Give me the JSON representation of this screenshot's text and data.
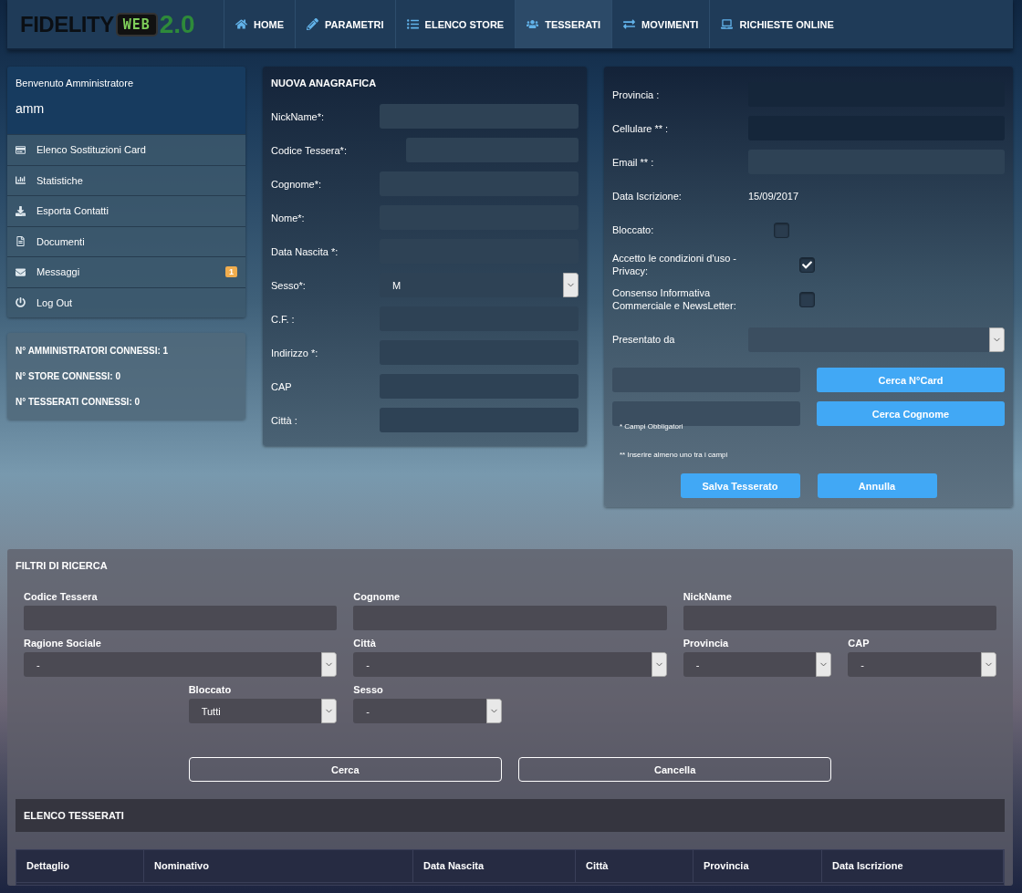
{
  "navbar": {
    "logo": {
      "word": "FIDELITY",
      "screen": "WEB",
      "version": "2.0"
    },
    "items": [
      {
        "label": "HOME",
        "selected": false
      },
      {
        "label": "PARAMETRI",
        "selected": false
      },
      {
        "label": "ELENCO STORE",
        "selected": false
      },
      {
        "label": "TESSERATI",
        "selected": true
      },
      {
        "label": "MOVIMENTI",
        "selected": false
      },
      {
        "label": "RICHIESTE ONLINE",
        "selected": false
      }
    ]
  },
  "sidebar": {
    "welcome": "Benvenuto Amministratore",
    "user": "amm",
    "items": [
      {
        "label": "Elenco Sostituzioni Card"
      },
      {
        "label": "Statistiche"
      },
      {
        "label": "Esporta Contatti"
      },
      {
        "label": "Documenti"
      },
      {
        "label": "Messaggi",
        "badge": "1"
      },
      {
        "label": "Log Out"
      }
    ],
    "stats": [
      "N° AMMINISTRATORI CONNESSI: 1",
      "N° STORE CONNESSI: 0",
      "N° TESSERATI CONNESSI: 0"
    ]
  },
  "new_record": {
    "title": "NUOVA ANAGRAFICA",
    "fields": [
      {
        "label": "NickName*:",
        "kind": "input"
      },
      {
        "label": "Codice Tessera*:",
        "kind": "short"
      },
      {
        "label": "Cognome*:",
        "kind": "input"
      },
      {
        "label": "Nome*:",
        "kind": "input"
      },
      {
        "label": "Data Nascita *:",
        "kind": "input"
      },
      {
        "label": "Sesso*:",
        "kind": "select",
        "value": "M"
      },
      {
        "label": "C.F. :",
        "kind": "input"
      },
      {
        "label": "Indirizzo *:",
        "kind": "input"
      },
      {
        "label": "CAP",
        "kind": "input"
      },
      {
        "label": "Città :",
        "kind": "input"
      }
    ]
  },
  "details": {
    "fields": [
      {
        "label": "Provincia :",
        "kind": "input"
      },
      {
        "label": "Cellulare ** :",
        "kind": "input"
      },
      {
        "label": "Email ** :",
        "kind": "input"
      },
      {
        "label": "Data Iscrizione:",
        "kind": "text",
        "value": "15/09/2017"
      },
      {
        "label": "Bloccato:",
        "kind": "checkbox",
        "checked": false
      },
      {
        "label": "Accetto le condizioni d'uso - Privacy:",
        "kind": "checkbox",
        "checked": true
      },
      {
        "label": "Consenso Informativa Commerciale e NewsLetter:",
        "kind": "checkbox",
        "checked": false
      },
      {
        "label": "Presentato da",
        "kind": "select"
      }
    ],
    "searches": [
      {
        "button": "Cerca N°Card"
      },
      {
        "button": "Cerca Cognome"
      }
    ],
    "notes": [
      "* Campi Obbligatori",
      "** Inserire almeno uno tra i campi"
    ],
    "buttons": [
      "Salva Tesserato",
      "Annulla"
    ]
  },
  "filters": {
    "title": "FILTRI DI RICERCA",
    "rows": [
      [
        {
          "label": "Codice Tessera",
          "kind": "input"
        },
        {
          "label": "Cognome",
          "kind": "input"
        },
        {
          "label": "NickName",
          "kind": "input"
        }
      ],
      [
        {
          "label": "Ragione Sociale",
          "kind": "select",
          "value": "-"
        },
        {
          "label": "Città",
          "kind": "select",
          "value": "-"
        },
        {
          "label": "Provincia",
          "kind": "select",
          "value": "-"
        },
        {
          "label": "CAP",
          "kind": "select",
          "value": "-"
        }
      ],
      [
        {
          "label": "Bloccato",
          "kind": "select",
          "value": "Tutti"
        },
        {
          "label": "Sesso",
          "kind": "select",
          "value": "-"
        }
      ]
    ],
    "buttons": [
      "Cerca",
      "Cancella"
    ]
  },
  "list": {
    "title": "ELENCO TESSERATI",
    "columns": [
      "Dettaglio",
      "Nominativo",
      "Data Nascita",
      "Città",
      "Provincia",
      "Data Iscrizione"
    ]
  }
}
